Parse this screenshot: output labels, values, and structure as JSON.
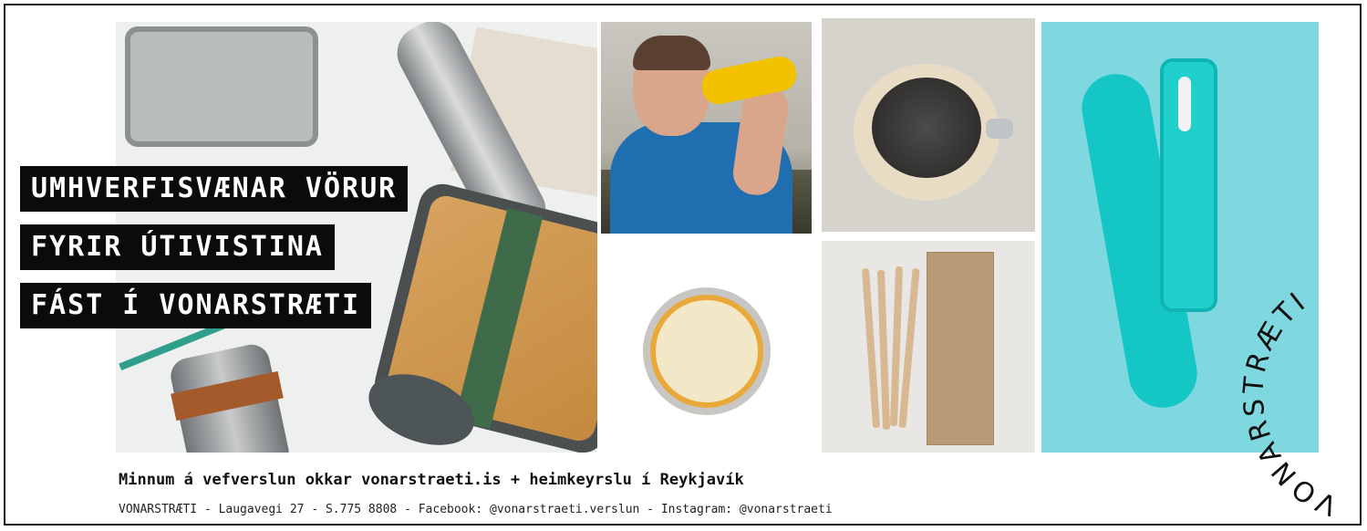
{
  "headline": {
    "line1": "UMHVERFISVÆNAR VÖRUR",
    "line2": "FYRIR ÚTIVISTINA",
    "line3": "FÁST Í VONARSTRÆTI"
  },
  "footer": {
    "main": "Minnum á vefverslun okkar vonarstraeti.is + heimkeyrslu í Reykjavík",
    "sub": "VONARSTRÆTI - Laugavegi 27 - S.775 8808 - Facebook: @vonarstraeti.verslun - Instagram: @vonarstraeti"
  },
  "logo": {
    "text": "VONARSTRÆTI"
  },
  "colors": {
    "label_bg": "#0b0b0b",
    "label_text": "#ffffff",
    "turquoise": "#7fd8e0"
  }
}
